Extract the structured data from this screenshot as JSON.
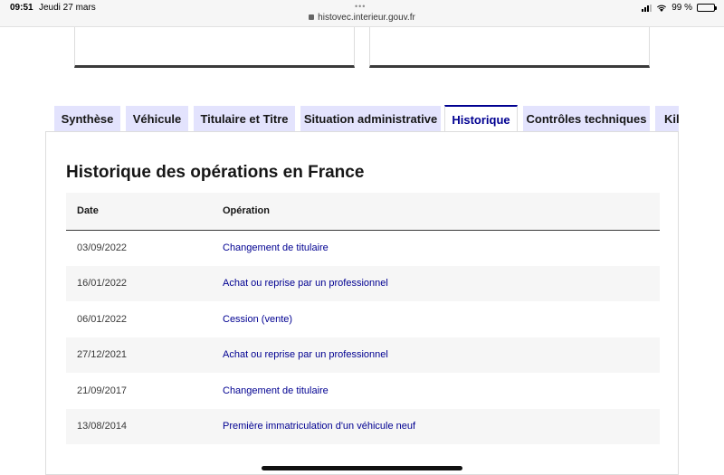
{
  "status_bar": {
    "time": "09:51",
    "date": "Jeudi 27 mars",
    "url": "histovec.interieur.gouv.fr",
    "battery": "99 %"
  },
  "tabs": [
    {
      "label": "Synthèse",
      "active": false
    },
    {
      "label": "Véhicule",
      "active": false
    },
    {
      "label": "Titulaire et Titre",
      "active": false
    },
    {
      "label": "Situation administrative",
      "active": false
    },
    {
      "label": "Historique",
      "active": true
    },
    {
      "label": "Contrôles techniques",
      "active": false
    },
    {
      "label": "Kil",
      "active": false
    }
  ],
  "panel": {
    "title": "Historique des opérations en France",
    "table": {
      "headers": {
        "date": "Date",
        "operation": "Opération"
      },
      "rows": [
        {
          "date": "03/09/2022",
          "operation": "Changement de titulaire"
        },
        {
          "date": "16/01/2022",
          "operation": "Achat ou reprise par un professionnel"
        },
        {
          "date": "06/01/2022",
          "operation": "Cession (vente)"
        },
        {
          "date": "27/12/2021",
          "operation": "Achat ou reprise par un professionnel"
        },
        {
          "date": "21/09/2017",
          "operation": "Changement de titulaire"
        },
        {
          "date": "13/08/2014",
          "operation": "Première immatriculation d'un véhicule neuf"
        }
      ]
    }
  },
  "colors": {
    "accent": "#000091",
    "tab_background": "#e3e3fd",
    "stripe": "#f6f6f6"
  }
}
